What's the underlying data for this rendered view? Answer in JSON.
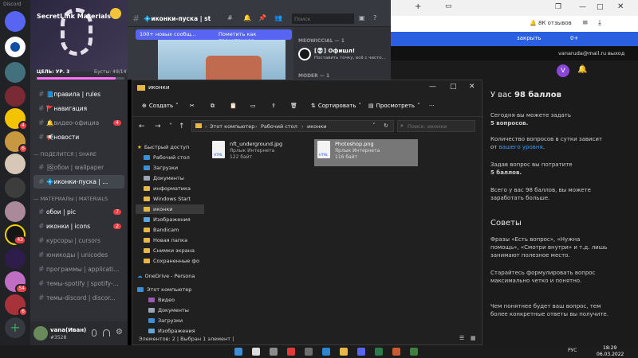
{
  "discord": {
    "app_name": "Discord",
    "server_name": "SecretLink Materials",
    "goal_label": "ЦЕЛЬ: УР. 3",
    "boosts_label": "Бусты: 49/14",
    "channels": [
      {
        "label": "📘правила | rules",
        "unread": true
      },
      {
        "label": "🚩навигация",
        "unread": true
      },
      {
        "label": "🔔видео-официа",
        "unread": false,
        "badge": "4"
      },
      {
        "label": "📢новости",
        "unread": true
      }
    ],
    "category1": "— ПОДЕЛИТСЯ | SHARE",
    "channels2": [
      {
        "label": "🖼обои | wallpaper",
        "unread": false
      },
      {
        "label": "💠иконки-пуска | ...",
        "unread": true
      }
    ],
    "category2": "— МАТЕРИАЛЫ | MATERIALS",
    "channels3": [
      {
        "label": "обои | pic",
        "unread": true,
        "badge": "7"
      },
      {
        "label": "иконки | icons",
        "unread": true,
        "badge": "2"
      },
      {
        "label": "курсоры | cursors",
        "unread": false
      },
      {
        "label": "юникоды | unicodes",
        "unread": false
      },
      {
        "label": "программы | applicati...",
        "unread": false
      },
      {
        "label": "темы-spotify | spotify-...",
        "unread": false
      },
      {
        "label": "темы-discord | discor...",
        "unread": false
      }
    ],
    "user_name": "vana(Иван)",
    "user_tag": "#3528",
    "server_badges": [
      "",
      "",
      "",
      "4",
      "6",
      "",
      "",
      "",
      "43",
      "",
      "54",
      "",
      "6",
      ""
    ],
    "channel_title": "💠иконки-пуска | st",
    "search_placeholder": "Поиск",
    "new_messages": "100+ новых сообщ...",
    "mark_read": "Пометить как прочитанное",
    "role1": "MEOWICCIAL — 1",
    "member1_name": "[💀] Офишл!",
    "member1_status": "Поставить точку, всё с чисто...",
    "role2": "MODER — 1"
  },
  "web": {
    "toolbar_text": "🔔 8К отзывов",
    "close_label": "закрыть",
    "count_label": "0+",
    "user_email": "vanaruda@mail.ru",
    "exit_label": "выход",
    "avatar_letter": "V",
    "points_prefix": "У вас ",
    "points_value": "98 баллов",
    "p1": "Сегодня вы можете задать",
    "p1b": "5 вопросов.",
    "p2a": "Количество вопросов в сутки зависит от ",
    "p2link": "вашего уровня",
    "p2b": ".",
    "p3": "Задав вопрос вы потратите",
    "p3b": "5 баллов.",
    "p4": "Всего у вас 98 баллов, вы можете заработать больше.",
    "tips_title": "Советы",
    "tip1": "Фразы «Есть вопрос», «Нужна помощь», «Смотри внутри» и т.д. лишь занимают полезное место.",
    "tip2": "Старайтесь формулировать вопрос максимально четко и понятно.",
    "tip3": "Чем понятнее будет ваш вопрос, тем более конкретные ответы вы получите."
  },
  "explorer": {
    "title": "иконки",
    "create": "Создать",
    "sort": "Сортировать",
    "view": "Просмотреть",
    "path": [
      "Этот компьютер",
      "Рабочий стол",
      "иконки"
    ],
    "search_placeholder": "Поиск: иконки",
    "quick_access": "Быстрый доступ",
    "nav": [
      "Рабочий стол",
      "Загрузки",
      "Документы",
      "информатика",
      "Windows Start",
      "иконки",
      "Изображения",
      "Bandicam",
      "Новая папка",
      "Снимки экрана",
      "Сохраненные фо"
    ],
    "onedrive": "OneDrive - Persona",
    "this_pc": "Этот компьютер",
    "pc_items": [
      "Видео",
      "Документы",
      "Загрузки",
      "Изображения"
    ],
    "files": [
      {
        "name": "nft_underground.jpg",
        "type": "Ярлык Интернета",
        "size": "122 байт"
      },
      {
        "name": "Photoshop.png",
        "type": "Ярлык Интернета",
        "size": "116 байт"
      }
    ],
    "status": "Элементов: 2  |  Выбран 1 элемент  |"
  },
  "taskbar": {
    "time": "18:29",
    "date": "06.03.2022",
    "lang": "РУС"
  },
  "colors": {
    "accent": "#5865f2",
    "folder": "#e8b847",
    "danger": "#ed4245",
    "link": "#3b99fc"
  }
}
